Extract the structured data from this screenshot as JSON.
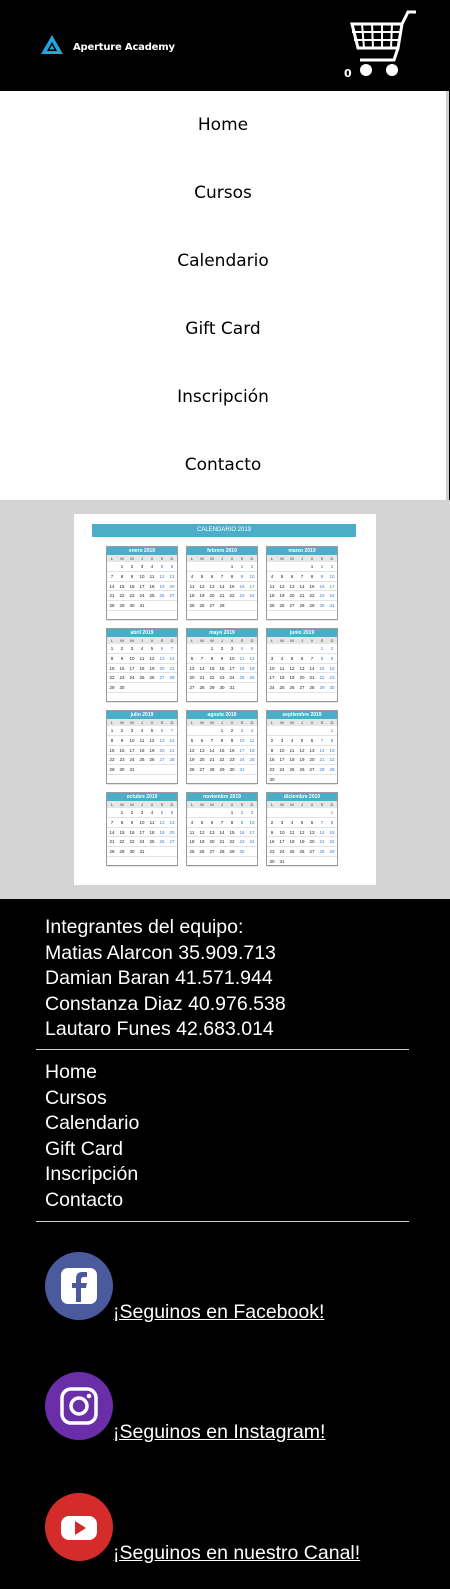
{
  "header": {
    "brand": "Aperture Academy",
    "cart_count": "0"
  },
  "nav": {
    "items": [
      "Home",
      "Cursos",
      "Calendario",
      "Gift Card",
      "Inscripción",
      "Contacto"
    ]
  },
  "calendar": {
    "title": "CALENDARIO 2019",
    "weekday_initials": [
      "L",
      "M",
      "M",
      "J",
      "V",
      "S",
      "D"
    ],
    "months": [
      {
        "name": "enero 2019",
        "start": 1,
        "days": 31
      },
      {
        "name": "febrero 2019",
        "start": 4,
        "days": 28
      },
      {
        "name": "marzo 2019",
        "start": 4,
        "days": 31
      },
      {
        "name": "abril 2019",
        "start": 0,
        "days": 30
      },
      {
        "name": "mayo 2019",
        "start": 2,
        "days": 31
      },
      {
        "name": "junio 2019",
        "start": 5,
        "days": 30
      },
      {
        "name": "julio 2019",
        "start": 0,
        "days": 31
      },
      {
        "name": "agosto 2019",
        "start": 3,
        "days": 31
      },
      {
        "name": "septiembre 2019",
        "start": 6,
        "days": 30
      },
      {
        "name": "octubre 2019",
        "start": 1,
        "days": 31
      },
      {
        "name": "noviembre 2019",
        "start": 4,
        "days": 30
      },
      {
        "name": "diciembre 2019",
        "start": 6,
        "days": 31
      }
    ]
  },
  "footer": {
    "team_heading": "Integrantes del equipo:",
    "members": [
      "Matias Alarcon 35.909.713",
      "Damian Baran 41.571.944",
      "Constanza Diaz 40.976.538",
      "Lautaro Funes 42.683.014"
    ],
    "links": [
      "Home",
      "Cursos",
      "Calendario",
      "Gift Card",
      "Inscripción",
      "Contacto"
    ],
    "social": {
      "facebook": "¡Seguinos en Facebook!",
      "instagram": "¡Seguinos en Instagram!",
      "youtube": "¡Seguinos en nuestro Canal!"
    },
    "colors": {
      "facebook": "#4a5a9c",
      "instagram": "#6a2fa8",
      "youtube": "#d42b2b"
    }
  }
}
